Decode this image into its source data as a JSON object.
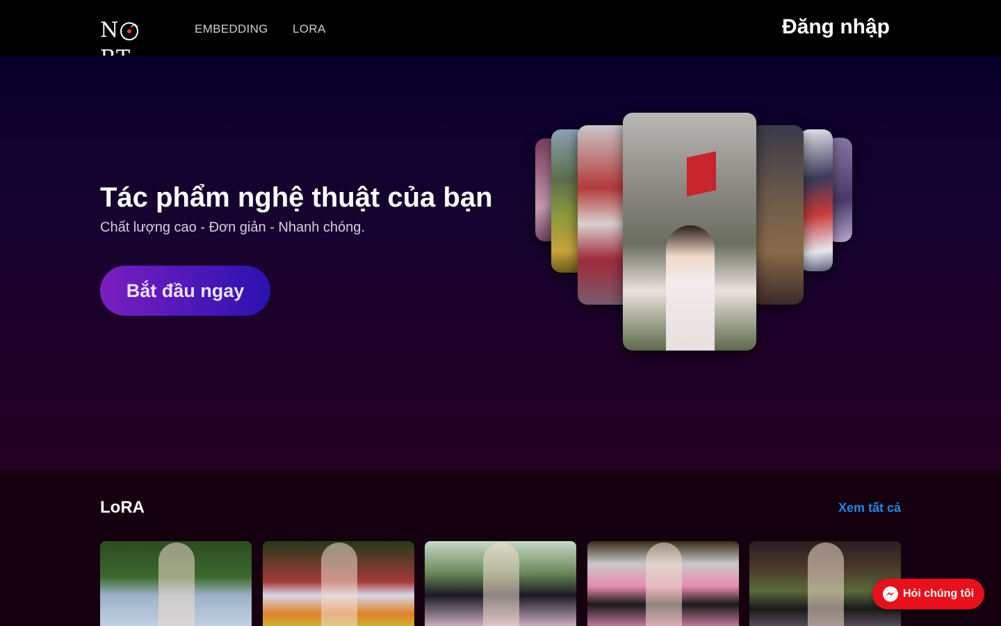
{
  "header": {
    "logo_text": "NORT",
    "nav": [
      "EMBEDDING",
      "LORA"
    ],
    "login_label": "Đăng nhập"
  },
  "hero": {
    "title": "Tác phẩm nghệ thuật của bạn",
    "subtitle": "Chất lượng cao - Đơn giản - Nhanh chóng.",
    "cta_label": "Bắt đầu ngay"
  },
  "lora_section": {
    "title": "LoRA",
    "see_all_label": "Xem tất cả"
  },
  "chat": {
    "label": "Hỏi chúng tôi",
    "icon": "messenger-icon"
  },
  "colors": {
    "accent_link": "#1e88e5",
    "chat_button": "#e8101a",
    "cta_gradient_start": "#7a1ec1",
    "cta_gradient_end": "#2a12b0"
  }
}
